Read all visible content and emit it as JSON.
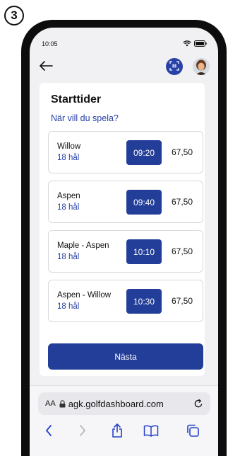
{
  "step": {
    "number": "3"
  },
  "status_bar": {
    "time": "10:05"
  },
  "header": {
    "back_icon": "arrow-left-icon",
    "scan_icon": "qr-scan-icon",
    "avatar_icon": "user-avatar"
  },
  "page": {
    "title": "Starttider",
    "subtitle": "När vill du spela?"
  },
  "tee_times": [
    {
      "course": "Willow",
      "holes": "18 hål",
      "time": "09:20",
      "price": "67,50"
    },
    {
      "course": "Aspen",
      "holes": "18 hål",
      "time": "09:40",
      "price": "67,50"
    },
    {
      "course": "Maple - Aspen",
      "holes": "18 hål",
      "time": "10:10",
      "price": "67,50"
    },
    {
      "course": "Aspen - Willow",
      "holes": "18 hål",
      "time": "10:30",
      "price": "67,50"
    }
  ],
  "actions": {
    "next_label": "Nästa"
  },
  "browser": {
    "text_size_label": "AA",
    "url": "agk.golfdashboard.com"
  },
  "colors": {
    "brand_blue": "#233e98",
    "link_blue": "#2741a8",
    "screen_bg": "#f1f1f3"
  }
}
